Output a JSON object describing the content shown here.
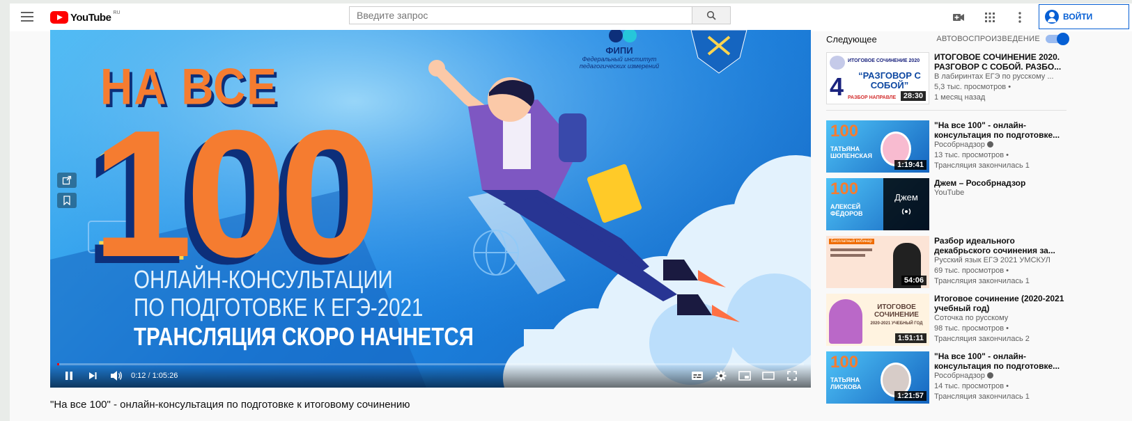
{
  "header": {
    "logo_text": "YouTube",
    "logo_region": "RU",
    "search_placeholder": "Введите запрос",
    "signin_label": "ВОЙТИ"
  },
  "player": {
    "headline": "НА ВСЕ",
    "big_number": "100",
    "subtitle_line1": "ОНЛАЙН-КОНСУЛЬТАЦИИ",
    "subtitle_line2": "ПО ПОДГОТОВКЕ К ЕГЭ-2021",
    "subtitle_line3": "ТРАНСЛЯЦИЯ СКОРО НАЧНЕТСЯ",
    "fipi_name": "ФИПИ",
    "fipi_sub": "Федеральный институт педагогических измерений",
    "current_time": "0:12",
    "time_separator": "/",
    "duration": "1:05:26",
    "progress_fraction": 0.003
  },
  "video_title": "\"На все 100\" - онлайн-консультация по подготовке к итоговому сочинению",
  "sidebar": {
    "up_next_label": "Следующее",
    "autoplay_label": "АВТОВОСПРОИЗВЕДЕНИЕ",
    "autoplay_on": true,
    "first": {
      "title": "ИТОГОВОЕ СОЧИНЕНИЕ 2020. РАЗГОВОР С СОБОЙ. РАЗБО...",
      "channel": "В лабиринтах ЕГЭ по русскому ...",
      "views": "5,3 тыс. просмотров •",
      "age": "1 месяц назад",
      "duration": "28:30",
      "thumb_top": "ИТОГОВОЕ СОЧИНЕНИЕ 2020",
      "thumb_quote": "“РАЗГОВОР С СОБОЙ”",
      "thumb_num": "4",
      "thumb_bottom": "РАЗБОР НАПРАВЛЕ"
    },
    "items": [
      {
        "title": "\"На все 100\" - онлайн-консультация по подготовке...",
        "channel": "Рособрнадзор",
        "verified": true,
        "views": "13 тыс. просмотров •",
        "status": "Трансляция закончилась 1",
        "duration": "1:19:41",
        "thumb_name": "ТАТЬЯНА ШОПЕНСКАЯ",
        "thumb_num": "100"
      },
      {
        "title": "Джем – Рособрнадзор",
        "channel": "YouTube",
        "verified": false,
        "views": "",
        "status": "",
        "duration": "",
        "thumb_name": "АЛЕКСЕЙ ФЁДОРОВ",
        "thumb_num": "100",
        "thumb_overlay": "Джем"
      },
      {
        "title": "Разбор идеального декабрьского сочинения за...",
        "channel": "Русский язык ЕГЭ 2021 УМСКУЛ",
        "verified": false,
        "views": "69 тыс. просмотров •",
        "status": "Трансляция закончилась 1",
        "duration": "54:06",
        "thumb_label": "Бесплатный вебинар"
      },
      {
        "title": "Итоговое сочинение (2020-2021 учебный год)",
        "channel": "Соточка по русскому",
        "verified": false,
        "views": "98 тыс. просмотров •",
        "status": "Трансляция закончилась 2",
        "duration": "1:51:11",
        "thumb_title": "ИТОГОВОЕ СОЧИНЕНИЕ",
        "thumb_sub": "2020-2021 УЧЕБНЫЙ ГОД"
      },
      {
        "title": "\"На все 100\" - онлайн-консультация по подготовке...",
        "channel": "Рособрнадзор",
        "verified": true,
        "views": "14 тыс. просмотров •",
        "status": "Трансляция закончилась 1",
        "duration": "1:21:57",
        "thumb_name": "ТАТЬЯНА ЛИСКОВА",
        "thumb_num": "100"
      }
    ]
  },
  "colors": {
    "brand_red": "#ff0000",
    "link_blue": "#065fd4",
    "accent_orange": "#f57c30",
    "navy": "#0d2f7a"
  }
}
